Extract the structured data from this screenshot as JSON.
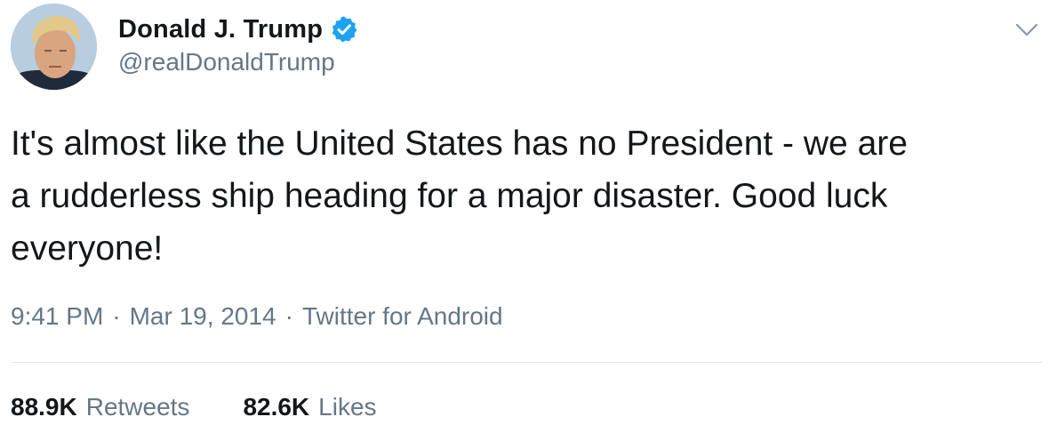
{
  "author": {
    "display_name": "Donald J. Trump",
    "handle": "@realDonaldTrump",
    "verified": true,
    "verified_color": "#1da1f2"
  },
  "tweet": {
    "text": "It's almost like the United States has no President - we are\na rudderless ship heading for a major disaster. Good luck\neveryone!",
    "time": "9:41 PM",
    "date": "Mar 19, 2014",
    "source": "Twitter for Android",
    "separator": "·"
  },
  "stats": {
    "retweets_count": "88.9K",
    "retweets_label": "Retweets",
    "likes_count": "82.6K",
    "likes_label": "Likes"
  },
  "icons": {
    "verified": "verified-badge-icon",
    "menu": "chevron-down-icon"
  },
  "colors": {
    "text_primary": "#14171a",
    "text_secondary": "#657786",
    "divider": "#e1e8ed"
  }
}
